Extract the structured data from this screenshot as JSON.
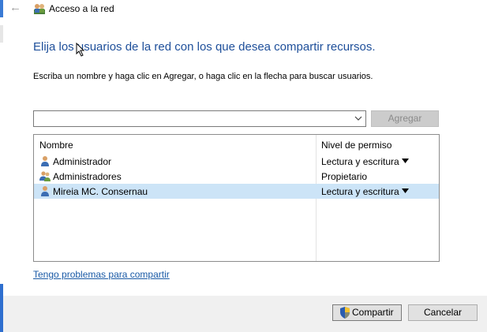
{
  "window": {
    "title": "Acceso a la red",
    "back_icon": "back-arrow-icon",
    "app_icon": "network-users-icon"
  },
  "main": {
    "heading": "Elija los usuarios de la red con los que desea compartir recursos.",
    "instruction": "Escriba un nombre y haga clic en Agregar, o haga clic en la flecha para buscar usuarios.",
    "user_input": {
      "value": "",
      "placeholder": ""
    },
    "add_label": "Agregar",
    "list": {
      "headers": {
        "name": "Nombre",
        "permission": "Nivel de permiso"
      },
      "rows": [
        {
          "name": "Administrador",
          "permission": "Lectura y escritura",
          "icon": "user-icon",
          "has_dropdown": true,
          "selected": false
        },
        {
          "name": "Administradores",
          "permission": "Propietario",
          "icon": "group-icon",
          "has_dropdown": false,
          "selected": false
        },
        {
          "name": "Mireia MC. Consernau",
          "permission": "Lectura y escritura",
          "icon": "user-icon",
          "has_dropdown": true,
          "selected": true
        }
      ]
    },
    "help_link": "Tengo problemas para compartir"
  },
  "footer": {
    "share_label": "Compartir",
    "cancel_label": "Cancelar"
  },
  "colors": {
    "heading": "#1e4f9a",
    "link": "#1a5aa6",
    "selected_row": "#cce4f7",
    "footer_bg": "#f0f0f0"
  }
}
